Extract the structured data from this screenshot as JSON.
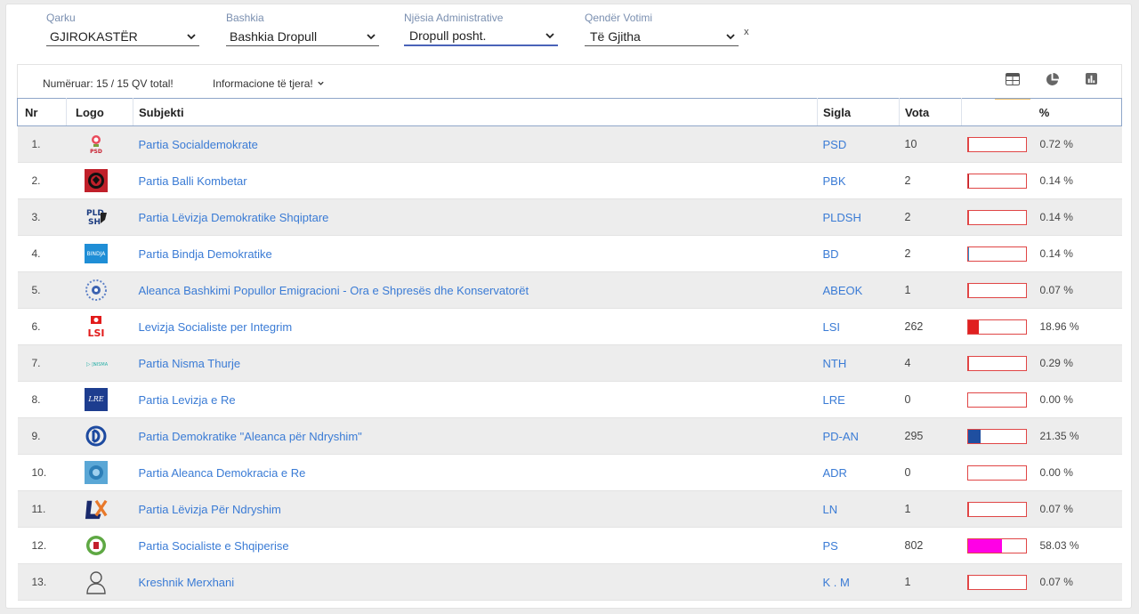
{
  "filters": {
    "qarku": {
      "label": "Qarku",
      "value": "GJIROKASTËR"
    },
    "bashkia": {
      "label": "Bashkia",
      "value": "Bashkia Dropull"
    },
    "njesia": {
      "label": "Njësia Administrative",
      "value": "Dropull posht."
    },
    "qender": {
      "label": "Qendër Votimi",
      "value": "Të Gjitha"
    },
    "clear": "x"
  },
  "info": {
    "numeruar": "Numëruar: 15 / 15 QV total!",
    "info_link": "Informacione të tjera!"
  },
  "views": [
    {
      "icon": "table-view-icon",
      "active": true
    },
    {
      "icon": "pie-chart-icon",
      "active": false
    },
    {
      "icon": "bar-chart-icon",
      "active": false
    }
  ],
  "table": {
    "headers": {
      "nr": "Nr",
      "logo": "Logo",
      "subjekti": "Subjekti",
      "sigla": "Sigla",
      "vota": "Vota",
      "pct": "%"
    },
    "rows": [
      {
        "nr": "1.",
        "logo": "psd-logo",
        "subjekti": "Partia Socialdemokrate",
        "sigla": "PSD",
        "vota": "10",
        "pct": "0.72 %",
        "pct_value": 0.72,
        "color": "#e04646"
      },
      {
        "nr": "2.",
        "logo": "pbk-logo",
        "subjekti": "Partia Balli Kombetar",
        "sigla": "PBK",
        "vota": "2",
        "pct": "0.14 %",
        "pct_value": 0.14,
        "color": "#c0202a"
      },
      {
        "nr": "3.",
        "logo": "pldsh-logo",
        "subjekti": "Partia Lëvizja Demokratike Shqiptare",
        "sigla": "PLDSH",
        "vota": "2",
        "pct": "0.14 %",
        "pct_value": 0.14,
        "color": "#e04646"
      },
      {
        "nr": "4.",
        "logo": "bd-logo",
        "subjekti": "Partia Bindja Demokratike",
        "sigla": "BD",
        "vota": "2",
        "pct": "0.14 %",
        "pct_value": 0.14,
        "color": "#2a8fd0"
      },
      {
        "nr": "5.",
        "logo": "abeok-logo",
        "subjekti": "Aleanca Bashkimi Popullor Emigracioni - Ora e Shpresës dhe Konservatorët",
        "sigla": "ABEOK",
        "vota": "1",
        "pct": "0.07 %",
        "pct_value": 0.07,
        "color": "#e04646"
      },
      {
        "nr": "6.",
        "logo": "lsi-logo",
        "subjekti": "Levizja Socialiste per Integrim",
        "sigla": "LSI",
        "vota": "262",
        "pct": "18.96 %",
        "pct_value": 18.96,
        "color": "#e02020"
      },
      {
        "nr": "7.",
        "logo": "nth-logo",
        "subjekti": "Partia Nisma Thurje",
        "sigla": "NTH",
        "vota": "4",
        "pct": "0.29 %",
        "pct_value": 0.29,
        "color": "#e04646"
      },
      {
        "nr": "8.",
        "logo": "lre-logo",
        "subjekti": "Partia Levizja e Re",
        "sigla": "LRE",
        "vota": "0",
        "pct": "0.00 %",
        "pct_value": 0,
        "color": "#e04646"
      },
      {
        "nr": "9.",
        "logo": "pd-logo",
        "subjekti": "Partia Demokratike \"Aleanca për Ndryshim\"",
        "sigla": "PD-AN",
        "vota": "295",
        "pct": "21.35 %",
        "pct_value": 21.35,
        "color": "#1f4fa0"
      },
      {
        "nr": "10.",
        "logo": "adr-logo",
        "subjekti": "Partia Aleanca Demokracia e Re",
        "sigla": "ADR",
        "vota": "0",
        "pct": "0.00 %",
        "pct_value": 0,
        "color": "#e04646"
      },
      {
        "nr": "11.",
        "logo": "ln-logo",
        "subjekti": "Partia Lëvizja Për Ndryshim",
        "sigla": "LN",
        "vota": "1",
        "pct": "0.07 %",
        "pct_value": 0.07,
        "color": "#e04646"
      },
      {
        "nr": "12.",
        "logo": "ps-logo",
        "subjekti": "Partia Socialiste e Shqiperise",
        "sigla": "PS",
        "vota": "802",
        "pct": "58.03 %",
        "pct_value": 58.03,
        "color": "#ff00e6"
      },
      {
        "nr": "13.",
        "logo": "person-icon",
        "subjekti": "Kreshnik Merxhani",
        "sigla": "K . M",
        "vota": "1",
        "pct": "0.07 %",
        "pct_value": 0.07,
        "color": "#e04646"
      }
    ]
  }
}
